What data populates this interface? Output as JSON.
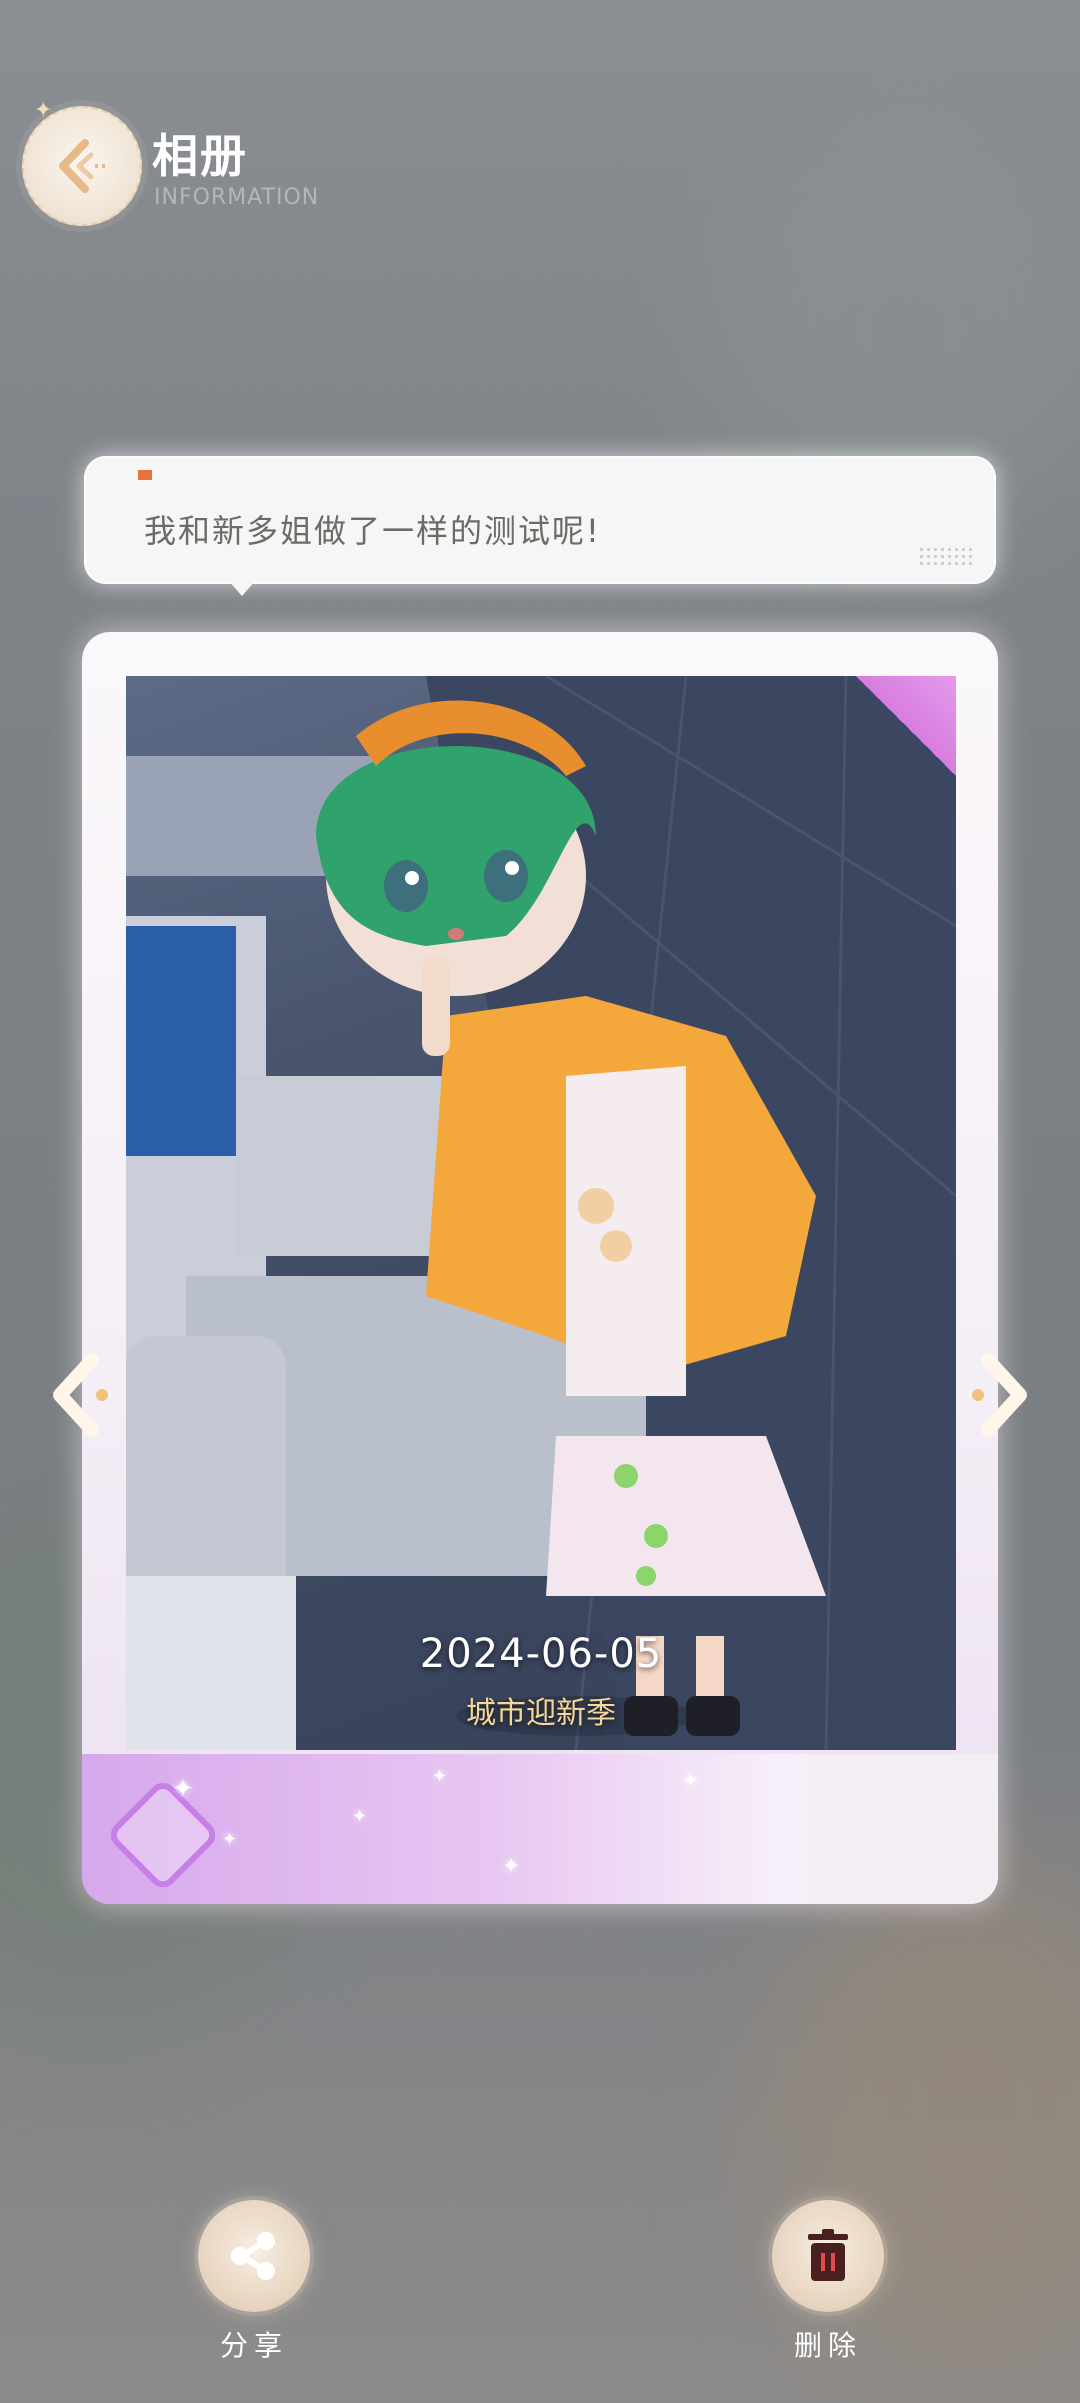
{
  "header": {
    "title": "相册",
    "subtitle": "INFORMATION",
    "back_icon": "back-arrow-icon"
  },
  "message": {
    "text": "我和新多姐做了一样的测试呢!"
  },
  "photo": {
    "date": "2024-06-05",
    "event": "城市迎新季"
  },
  "actions": {
    "share_label": "分享",
    "delete_label": "删除"
  },
  "colors": {
    "accent_purple": "#c57fe6",
    "accent_gold": "#f6d79a",
    "delete_icon": "#4a1f1f"
  }
}
